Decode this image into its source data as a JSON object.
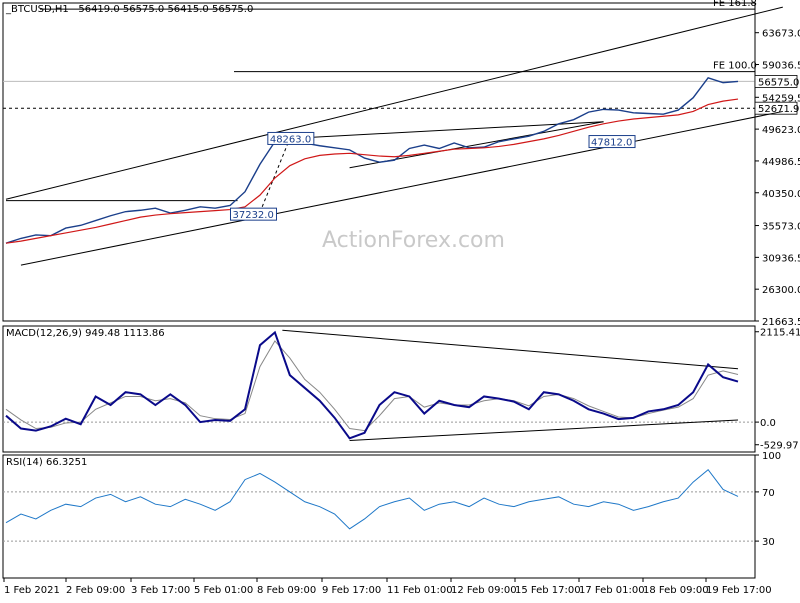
{
  "chart_data": [
    {
      "type": "line",
      "panel": "price",
      "symbol_label": "_BTCUSD,H1",
      "ohlc_header": [
        "56419.0",
        "56575.0",
        "56415.0",
        "56575.0"
      ],
      "watermark": "ActionForex.com",
      "ylim": [
        21663.5,
        68000
      ],
      "y_ticks": [
        63673.0,
        59036.5,
        54259.5,
        49623.0,
        44986.5,
        40350.0,
        35573.0,
        30936.5,
        26300.0,
        21663.5
      ],
      "y_tick_labels": [
        "63673.0",
        "59036.5",
        "54259.5",
        "49623.0",
        "44986.5",
        "40350.0",
        "35573.0",
        "30936.5",
        "26300.0",
        "21663.5"
      ],
      "current_price_label": "56575.0",
      "current_price": 56575.0,
      "support_level_label": "52671.9",
      "support_level": 52671.9,
      "fe_levels": [
        {
          "label": "FE 161.8",
          "value": 67100
        },
        {
          "label": "FE 100.0",
          "value": 58000
        }
      ],
      "annotations": [
        {
          "label": "48263.0",
          "value": 48263.0
        },
        {
          "label": "37232.0",
          "value": 37232.0
        },
        {
          "label": "47812.0",
          "value": 47812.0
        }
      ],
      "x_tick_labels": [
        "1 Feb 2021",
        "2 Feb 09:00",
        "3 Feb 17:00",
        "5 Feb 01:00",
        "8 Feb 09:00",
        "9 Feb 17:00",
        "11 Feb 01:00",
        "12 Feb 09:00",
        "15 Feb 17:00",
        "17 Feb 01:00",
        "18 Feb 09:00",
        "19 Feb 17:00"
      ],
      "series": [
        {
          "role": "price",
          "color": "#1b3f8b",
          "values": [
            33000,
            33700,
            34200,
            34100,
            35200,
            35600,
            36300,
            37000,
            37600,
            37800,
            38100,
            37400,
            37800,
            38300,
            38100,
            38500,
            40500,
            44500,
            47800,
            48000,
            47600,
            47200,
            46900,
            46600,
            45400,
            44800,
            45100,
            46800,
            47300,
            46800,
            47600,
            46900,
            47000,
            47800,
            48200,
            48600,
            49300,
            50400,
            51000,
            52100,
            52500,
            52400,
            52000,
            51900,
            51800,
            52400,
            54200,
            57100,
            56400,
            56575
          ]
        },
        {
          "role": "moving_average",
          "color": "#d01818",
          "values": [
            33000,
            33300,
            33700,
            34100,
            34500,
            34900,
            35300,
            35800,
            36300,
            36800,
            37100,
            37300,
            37450,
            37600,
            37750,
            37900,
            38300,
            40000,
            42500,
            44300,
            45300,
            45800,
            46000,
            46100,
            45900,
            45700,
            45600,
            45800,
            46100,
            46400,
            46700,
            46800,
            46900,
            47100,
            47400,
            47800,
            48200,
            48700,
            49300,
            49900,
            50400,
            50800,
            51100,
            51300,
            51500,
            51700,
            52200,
            53200,
            53700,
            54000
          ]
        }
      ]
    },
    {
      "type": "line",
      "panel": "macd",
      "label": "MACD(12,26,9) 949.48 1113.86",
      "ylim": [
        -700,
        2250
      ],
      "y_ticks": [
        2115.41,
        0.0,
        -529.97
      ],
      "y_tick_labels": [
        "2115.41",
        "0.0",
        "-529.97"
      ],
      "series": [
        {
          "role": "macd",
          "color": "#0a0a8a",
          "values": [
            150,
            -150,
            -200,
            -100,
            80,
            -50,
            600,
            400,
            700,
            650,
            400,
            650,
            400,
            0,
            50,
            30,
            300,
            1800,
            2100,
            1100,
            800,
            500,
            100,
            -380,
            -250,
            400,
            700,
            600,
            200,
            500,
            400,
            350,
            600,
            550,
            480,
            300,
            700,
            650,
            500,
            300,
            200,
            70,
            100,
            250,
            300,
            400,
            700,
            1350,
            1050,
            949.48
          ]
        },
        {
          "role": "signal",
          "color": "#888888",
          "values": [
            300,
            50,
            -150,
            -120,
            -20,
            0,
            300,
            450,
            600,
            600,
            500,
            550,
            450,
            150,
            80,
            60,
            200,
            1300,
            1900,
            1500,
            1000,
            700,
            300,
            -150,
            -200,
            150,
            550,
            600,
            350,
            450,
            400,
            400,
            500,
            550,
            500,
            380,
            600,
            650,
            550,
            380,
            250,
            120,
            100,
            200,
            280,
            350,
            550,
            1100,
            1200,
            1113.86
          ]
        }
      ]
    },
    {
      "type": "line",
      "panel": "rsi",
      "label": "RSI(14) 66.3251",
      "ylim": [
        0,
        100
      ],
      "y_ticks": [
        100,
        70,
        30
      ],
      "y_tick_labels": [
        "100",
        "70",
        "30"
      ],
      "series": [
        {
          "role": "rsi",
          "color": "#1f78c8",
          "values": [
            45,
            52,
            48,
            55,
            60,
            58,
            65,
            68,
            62,
            66,
            60,
            58,
            64,
            60,
            55,
            62,
            80,
            85,
            78,
            70,
            62,
            58,
            52,
            40,
            48,
            58,
            62,
            65,
            55,
            60,
            62,
            58,
            65,
            60,
            58,
            62,
            64,
            66,
            60,
            58,
            62,
            60,
            55,
            58,
            62,
            65,
            78,
            88,
            72,
            66.3251
          ]
        }
      ]
    }
  ]
}
